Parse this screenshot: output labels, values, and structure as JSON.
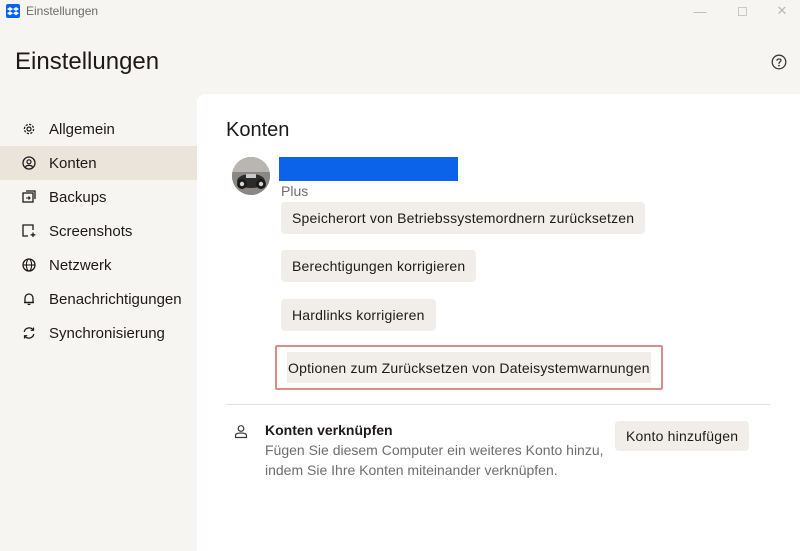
{
  "window": {
    "title": "Einstellungen",
    "minimize_glyph": "—",
    "close_glyph": "✕"
  },
  "header": {
    "title": "Einstellungen",
    "help_icon": "question-circle-icon"
  },
  "sidebar": {
    "items": [
      {
        "label": "Allgemein",
        "icon": "gear-icon",
        "active": false
      },
      {
        "label": "Konten",
        "icon": "account-circle-icon",
        "active": true
      },
      {
        "label": "Backups",
        "icon": "backup-icon",
        "active": false
      },
      {
        "label": "Screenshots",
        "icon": "screenshot-icon",
        "active": false
      },
      {
        "label": "Netzwerk",
        "icon": "globe-icon",
        "active": false
      },
      {
        "label": "Benachrichtigungen",
        "icon": "bell-icon",
        "active": false
      },
      {
        "label": "Synchronisierung",
        "icon": "sync-icon",
        "active": false
      }
    ]
  },
  "main": {
    "section_title": "Konten",
    "account": {
      "plan": "Plus",
      "name_redaction_color": "#0a63e8"
    },
    "buttons": {
      "reset_os_folders": "Speicherort von Betriebssystemordnern zurücksetzen",
      "fix_permissions": "Berechtigungen korrigieren",
      "fix_hardlinks": "Hardlinks korrigieren",
      "reset_fs_warnings": "Optionen zum Zurücksetzen von Dateisystemwarnungen"
    },
    "link_accounts": {
      "title": "Konten verknüpfen",
      "description": "Fügen Sie diesem Computer ein weiteres Konto hinzu, indem Sie Ihre Konten miteinander verknüpfen.",
      "button": "Konto hinzufügen",
      "icon": "person-icon"
    },
    "highlight_color": "#d98c88"
  }
}
